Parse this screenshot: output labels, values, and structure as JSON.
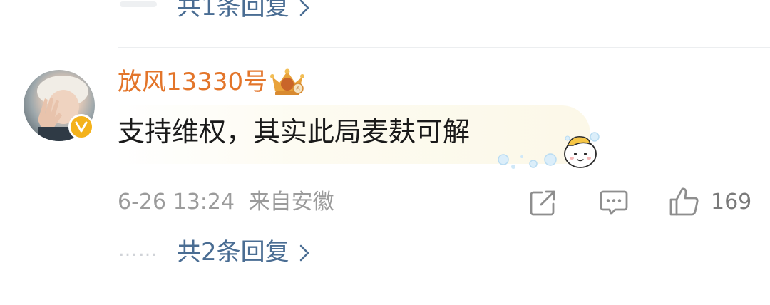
{
  "previous_comment": {
    "reply_link": "共1条回复"
  },
  "comment": {
    "username": "放风13330号",
    "text": "支持维权，其实此局麦麸可解",
    "timestamp": "6-26 13:24",
    "location": "来自安徽",
    "like_count": "169",
    "reply_link": "共2条回复",
    "reply_dots": "……",
    "badges": [
      "verified-v-badge",
      "crown-rank-badge"
    ]
  },
  "icons": {
    "share": "share-icon",
    "comment": "comment-icon",
    "like": "thumbs-up-icon",
    "chevron": "chevron-right-icon"
  },
  "colors": {
    "username": "#e3752a",
    "reply_link": "#4a6d93",
    "meta": "#9b9b9b",
    "verified": "#f4b21b"
  }
}
